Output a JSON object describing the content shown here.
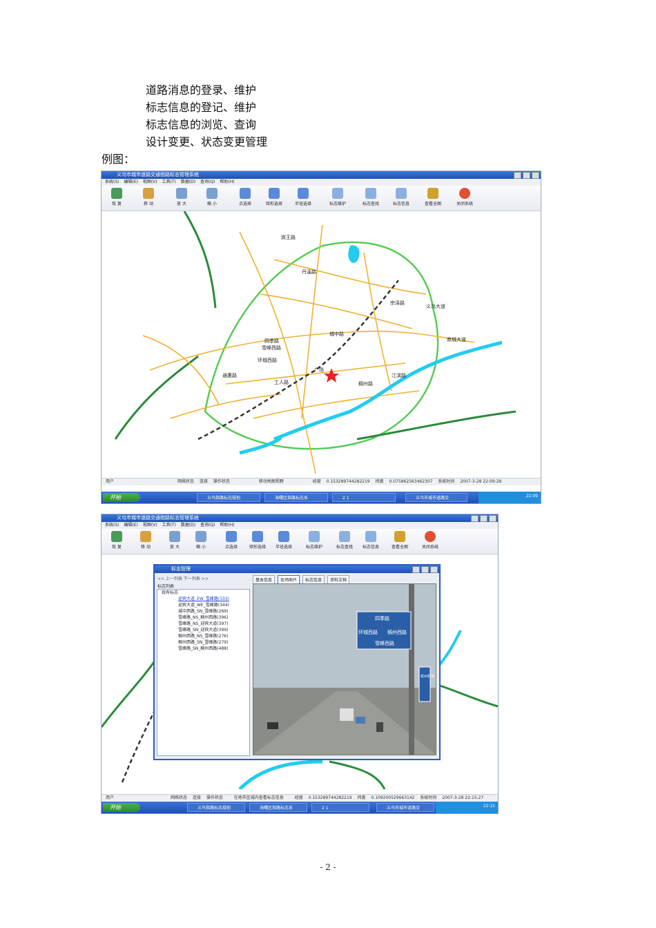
{
  "text_lines": [
    "道路消息的登录、维护",
    "标志信息的登记、维护",
    "标志信息的浏览、查询",
    "设计变更、状态变更管理"
  ],
  "example_label": "例图：",
  "page_number": "- 2 -",
  "app": {
    "title": "义乌市城市道路交通指路标志管理系统",
    "menu": [
      "系统(S)",
      "编辑(E)",
      "视图(V)",
      "工具(T)",
      "数据(D)",
      "查询(Q)",
      "帮助(H)"
    ],
    "tools": [
      {
        "label": "恢 复",
        "icon": "restore-icon"
      },
      {
        "label": "移 动",
        "icon": "pan-icon"
      },
      {
        "label": "放 大",
        "icon": "zoom-in-icon"
      },
      {
        "label": "缩 小",
        "icon": "zoom-out-icon"
      },
      {
        "label": "点选择",
        "icon": "point-select-icon"
      },
      {
        "label": "矩形选择",
        "icon": "rect-select-icon"
      },
      {
        "label": "半径选择",
        "icon": "radius-select-icon"
      },
      {
        "label": "标志维护",
        "icon": "sign-maintain-icon"
      },
      {
        "label": "标志查找",
        "icon": "sign-find-icon"
      },
      {
        "label": "标志信息",
        "icon": "sign-info-icon"
      },
      {
        "label": "查看全图",
        "icon": "full-extent-icon"
      },
      {
        "label": "关闭系统",
        "icon": "close-system-icon"
      }
    ],
    "colors": {
      "title": "#1f4fb8",
      "taskbar": "#2a5fc8",
      "start": "#3aa03a",
      "road_major": "#f0b030",
      "road_ring": "#55cc55",
      "river": "#22ccee",
      "rail": "#333333"
    }
  },
  "screenshot1": {
    "map_labels": [
      "广场",
      "环城西路",
      "雪峰西路",
      "四季路",
      "宾王路",
      "丹溪路",
      "稠州路",
      "江滨路",
      "城中路",
      "工人路",
      "义乌大道",
      "宗泽路",
      "通惠路",
      "商城大道"
    ],
    "status": {
      "user": "用户",
      "net": "网络状态",
      "conn": "连接",
      "op": "操作状态",
      "action": "移动地图视野",
      "lon_label": "经度",
      "lon": "0.153289744282219",
      "lat_label": "纬度",
      "lat": "0.075862563462307",
      "time_label": "系统时间",
      "time": "2007-3-28 22:09:28"
    },
    "taskbar": {
      "start": "开始",
      "tasks": [
        "义乌指路标志规划",
        "海曙区指路标志系",
        "2 1",
        "义乌市城市道路交"
      ],
      "clock": "22:09"
    }
  },
  "screenshot2": {
    "dialog": {
      "title": "标志管理",
      "nav": [
        "<< 上一列表",
        "下一列表 >>"
      ],
      "tabs": [
        "基本信息",
        "现场图片",
        "标志信息",
        "资料文档"
      ],
      "active_tab": "现场图片",
      "list_title": "标志列表",
      "tree_root": "现有标志",
      "items": [
        "迎宾大道_EW_雪峰路(333)",
        "迎宾大道_WE_雪峰路(344)",
        "城中西路_SN_雪峰路(269)",
        "雪峰路_NS_稠州西路(396)",
        "雪峰路_NS_迎宾大道(397)",
        "雪峰路_SN_迎宾大道(399)",
        "稠州西路_NS_雪峰路(276)",
        "稠州西路_SN_雪峰路(279)",
        "雪峰路_SN_稠州西路(488)"
      ],
      "photo_sign": {
        "top": "四季路",
        "left": "环城西路",
        "right": "稠州西路",
        "bottom": "雪峰西路",
        "side": "杭州机场"
      }
    },
    "status": {
      "user": "用户",
      "net": "网络状态",
      "conn": "连接",
      "op": "操作状态",
      "action": "在地市区城内查看标志信息",
      "lon_label": "经度",
      "lon": "0.153289744282219",
      "lat_label": "纬度",
      "lat": "0.109200529663142",
      "time_label": "系统时间",
      "time": "2007-3-28 22:15:27"
    },
    "taskbar": {
      "start": "开始",
      "tasks": [
        "义乌指路标志规划",
        "海曙区指路标志系",
        "2 1",
        "义乌市城市道路交"
      ],
      "clock": "22:15"
    }
  }
}
